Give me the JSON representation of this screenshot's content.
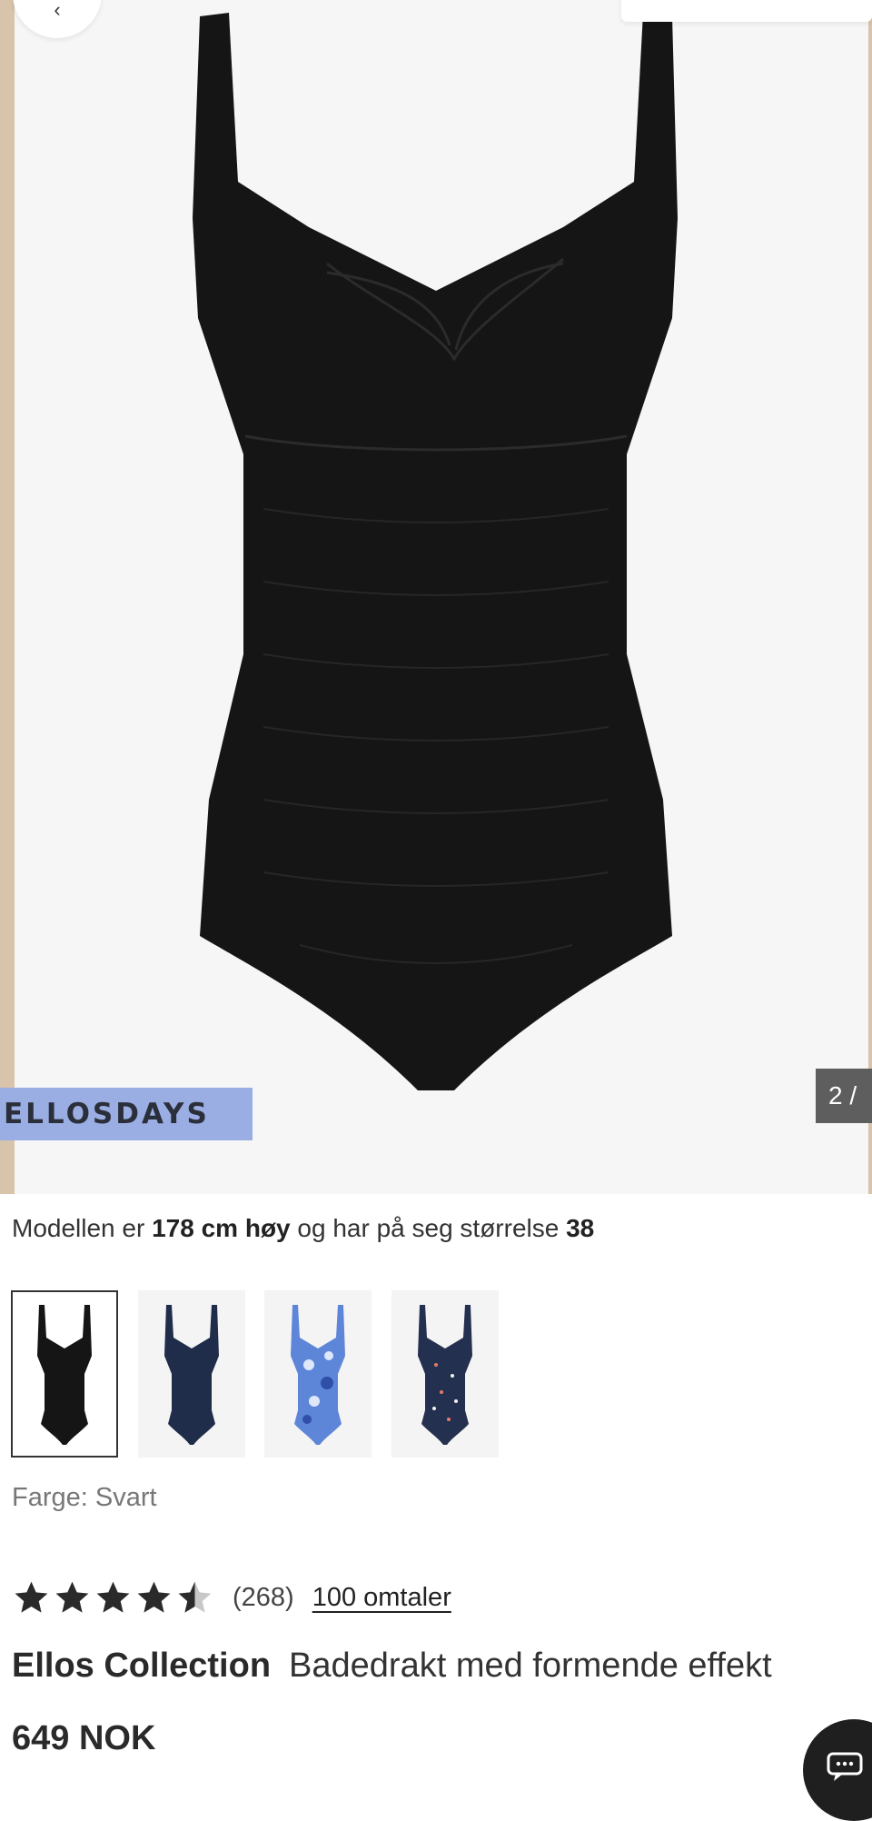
{
  "hero": {
    "promo_badge": "ELLOSDAYS",
    "image_counter": "2 /"
  },
  "model_info": {
    "part1": "Modellen er ",
    "height": "178 cm høy",
    "part2": " og har på seg størrelse ",
    "size": "38"
  },
  "color_options": [
    {
      "name": "Svart",
      "color": "#151515",
      "selected": true
    },
    {
      "name": "navy",
      "color": "#1f2c4a",
      "selected": false
    },
    {
      "name": "blue-floral",
      "color": "#5d86d8",
      "selected": false
    },
    {
      "name": "navy-print",
      "color": "#24304f",
      "selected": false
    }
  ],
  "color_label": "Farge: Svart",
  "rating": {
    "stars": 4.5,
    "count": "(268)",
    "reviews_link": "100 omtaler"
  },
  "product": {
    "brand": "Ellos Collection",
    "name": "Badedrakt med formende effekt",
    "price": "649 NOK"
  },
  "colors": {
    "promo": "#9aaee4",
    "star": "#2a2a2a",
    "star_empty": "#c8c8c8"
  }
}
